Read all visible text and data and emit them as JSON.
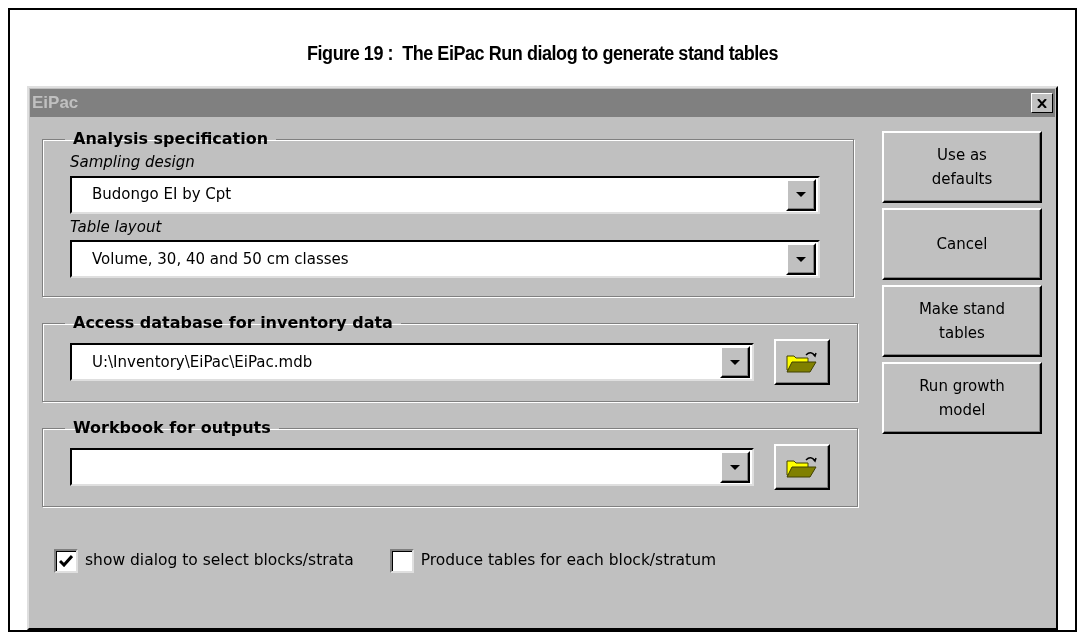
{
  "figure_caption": "Figure 19 :  The EiPac Run dialog to generate stand tables",
  "window": {
    "title": "EiPac"
  },
  "groups": [
    {
      "title": "Analysis specification",
      "fields": [
        {
          "label": "Sampling design",
          "value": "Budongo EI by Cpt",
          "browse": false
        },
        {
          "label": "Table layout",
          "value": "Volume, 30, 40 and 50 cm classes",
          "browse": false
        }
      ]
    },
    {
      "title": "Access database for inventory data",
      "fields": [
        {
          "value": "U:\\Inventory\\EiPac\\EiPac.mdb",
          "browse": true
        }
      ]
    },
    {
      "title": "Workbook for outputs",
      "fields": [
        {
          "browse": true
        }
      ]
    }
  ],
  "buttons": [
    "Use as defaults",
    "Cancel",
    "Make stand tables",
    "Run growth model"
  ],
  "checkboxes": [
    {
      "label": "show dialog to select blocks/strata",
      "checked": true
    },
    {
      "label": "Produce tables for each block/stratum",
      "checked": false
    }
  ]
}
